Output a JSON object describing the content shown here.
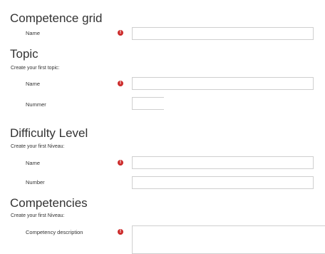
{
  "competence_grid": {
    "heading": "Competence grid",
    "name_label": "Name",
    "name_value": ""
  },
  "topic": {
    "heading": "Topic",
    "subtext": "Create your first topic:",
    "name_label": "Name",
    "name_value": "",
    "number_label": "Nummer",
    "number_value": ""
  },
  "difficulty_level": {
    "heading": "Difficulty Level",
    "subtext": "Create your first Niveau:",
    "name_label": "Name",
    "name_value": "",
    "number_label": "Number",
    "number_value": ""
  },
  "competencies": {
    "heading": "Competencies",
    "subtext": "Create your first Niveau:",
    "description_label": "Competency description",
    "description_value": ""
  },
  "required_icon": {
    "name": "exclamation-circle-icon",
    "glyph": "!",
    "color": "#cc2b2b"
  }
}
